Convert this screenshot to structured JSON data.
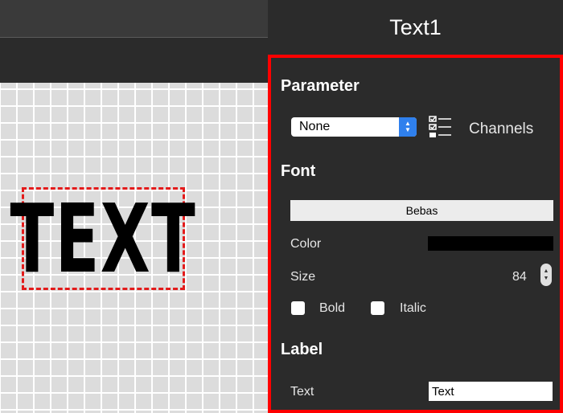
{
  "canvas": {
    "text_object_label": "TEXT"
  },
  "inspector": {
    "title": "Text1",
    "parameter": {
      "heading": "Parameter",
      "selected": "None",
      "channels_label": "Channels"
    },
    "font": {
      "heading": "Font",
      "font_name": "Bebas",
      "color_label": "Color",
      "color_value": "#000000",
      "size_label": "Size",
      "size_value": "84",
      "bold_label": "Bold",
      "italic_label": "Italic",
      "bold_checked": false,
      "italic_checked": false
    },
    "label": {
      "heading": "Label",
      "text_label": "Text",
      "text_value": "Text"
    }
  },
  "colors": {
    "selection_border": "#ff0000",
    "accent": "#2f80ed"
  }
}
